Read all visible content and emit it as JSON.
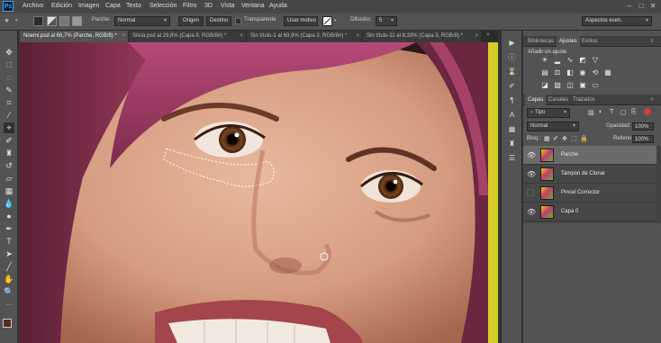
{
  "app": {
    "logo_text": "Ps"
  },
  "menu": [
    "Archivo",
    "Edición",
    "Imagen",
    "Capa",
    "Texto",
    "Selección",
    "Filtro",
    "3D",
    "Vista",
    "Ventana",
    "Ayuda"
  ],
  "options_bar": {
    "patch_label": "Parche:",
    "patch_mode": "Normal",
    "source_button": "Origen",
    "destination_button": "Destino",
    "transparent_label": "Transparente",
    "use_pattern_button": "Usar motivo",
    "diffusion_label": "Difusión:",
    "diffusion_value": "5",
    "workspace": "Aspectos esen."
  },
  "document_tabs": [
    {
      "label": "Noemi.psd al 66,7% (Parche, RGB/8) *",
      "active": true
    },
    {
      "label": "Silvia.psd al 29,8% (Capa 9, RGB/8#) *",
      "active": false
    },
    {
      "label": "Sin título-1 al 69,9% (Capa 3, RGB/8#) *",
      "active": false
    },
    {
      "label": "Sin título-11 al 8,33% (Capa 3, RGB/8) *",
      "active": false
    }
  ],
  "adjustments_panel": {
    "tabs": [
      "Bibliotecas",
      "Ajustes",
      "Estilos"
    ],
    "active_tab": "Ajustes",
    "heading": "Añadir un ajuste"
  },
  "layers_panel": {
    "tabs": [
      "Capas",
      "Canales",
      "Trazados"
    ],
    "active_tab": "Capas",
    "filter_kind": "Tipo",
    "blend_mode": "Normal",
    "opacity_label": "Opacidad:",
    "opacity_value": "100%",
    "lock_label": "Bloq.:",
    "fill_label": "Relleno:",
    "fill_value": "100%",
    "layers": [
      {
        "name": "Parche",
        "visible": true,
        "selected": true
      },
      {
        "name": "Tampón de Clonar",
        "visible": true,
        "selected": false
      },
      {
        "name": "Pincel Corrector",
        "visible": false,
        "selected": false
      },
      {
        "name": "Capa 0",
        "visible": true,
        "selected": false
      }
    ]
  },
  "colors": {
    "foreground": "#5a2a22",
    "background": "#d4705a",
    "accent": "#31a8ff"
  }
}
